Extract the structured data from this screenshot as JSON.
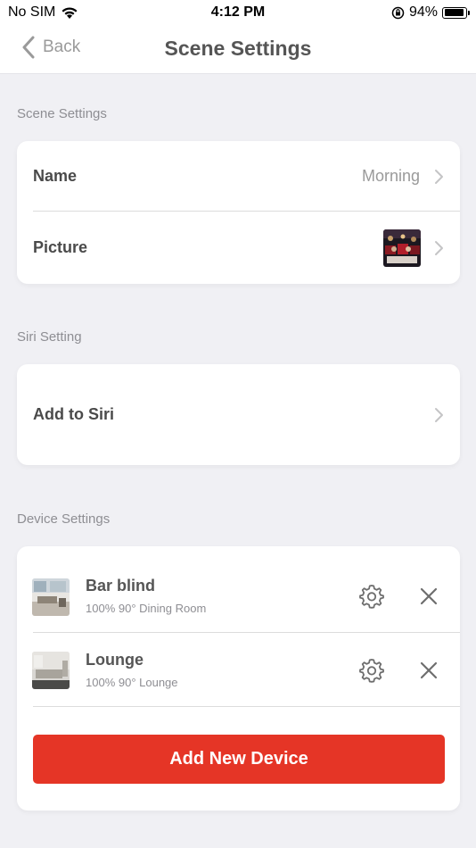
{
  "status": {
    "carrier": "No SIM",
    "time": "4:12 PM",
    "battery": "94%",
    "battery_level": 0.94
  },
  "nav": {
    "back_label": "Back",
    "title": "Scene Settings"
  },
  "scene_section": {
    "label": "Scene Settings",
    "name_label": "Name",
    "name_value": "Morning",
    "picture_label": "Picture"
  },
  "siri_section": {
    "label": "Siri Setting",
    "add_label": "Add to Siri"
  },
  "device_section": {
    "label": "Device Settings",
    "devices": [
      {
        "name": "Bar blind",
        "details": "100% 90° Dining Room"
      },
      {
        "name": "Lounge",
        "details": "100% 90° Lounge"
      }
    ],
    "add_button": "Add New Device"
  },
  "colors": {
    "accent": "#e53526",
    "background": "#f0f0f4"
  }
}
